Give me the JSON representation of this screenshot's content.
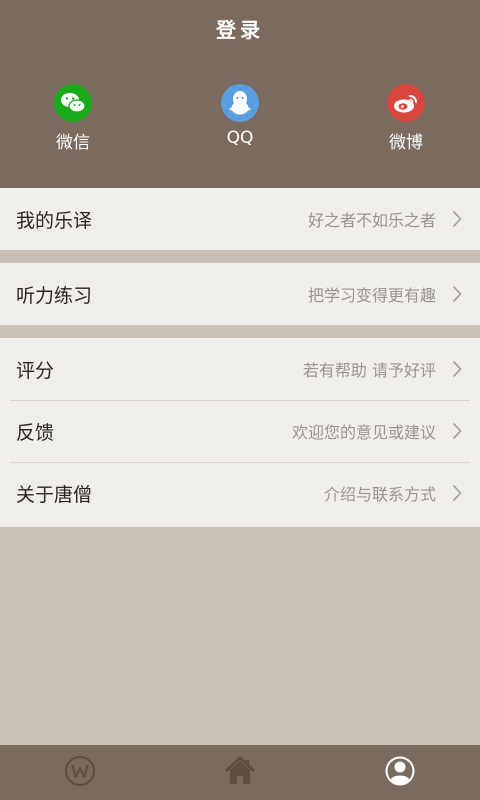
{
  "header": {
    "title": "登录",
    "login_options": [
      {
        "label": "微信",
        "icon": "wechat-icon",
        "color": "#1aab1a"
      },
      {
        "label": "QQ",
        "icon": "qq-penguin-icon",
        "color": "#5a9ee0"
      },
      {
        "label": "微博",
        "icon": "weibo-icon",
        "color": "#d8473d"
      }
    ]
  },
  "menu": {
    "groups": [
      [
        {
          "title": "我的乐译",
          "subtitle": "好之者不如乐之者"
        }
      ],
      [
        {
          "title": "听力练习",
          "subtitle": "把学习变得更有趣"
        }
      ],
      [
        {
          "title": "评分",
          "subtitle": "若有帮助 请予好评"
        },
        {
          "title": "反馈",
          "subtitle": "欢迎您的意见或建议"
        },
        {
          "title": "关于唐僧",
          "subtitle": "介绍与联系方式"
        }
      ]
    ]
  },
  "tabbar": {
    "tabs": [
      {
        "name": "word",
        "icon": "w-circle-icon",
        "active": false
      },
      {
        "name": "home",
        "icon": "home-icon",
        "active": false
      },
      {
        "name": "profile",
        "icon": "profile-icon",
        "active": true
      }
    ]
  },
  "colors": {
    "header_bg": "#7b6a5e",
    "page_bg": "#c9c0b8",
    "row_bg": "#f0eeeb",
    "tab_inactive": "#5e4f45",
    "tab_active": "#ffffff"
  }
}
